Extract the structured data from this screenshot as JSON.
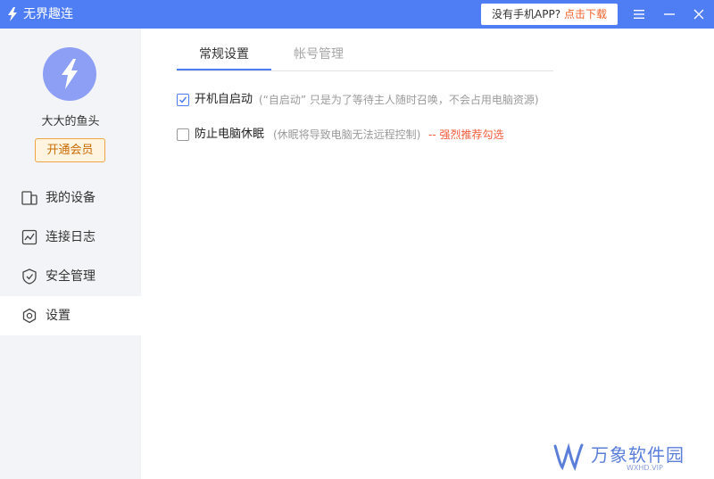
{
  "app": {
    "title": "无界趣连",
    "brand_color": "#4f7df3"
  },
  "titlebar": {
    "download_prompt": "没有手机APP?",
    "download_link": "点击下载",
    "menu_icon": "hamburger-menu-icon",
    "minimize_icon": "minimize-icon",
    "close_icon": "close-icon"
  },
  "sidebar": {
    "username": "大大的鱼头",
    "vip_button": "开通会员",
    "items": [
      {
        "label": "我的设备",
        "icon": "devices-icon",
        "active": false
      },
      {
        "label": "连接日志",
        "icon": "log-chart-icon",
        "active": false
      },
      {
        "label": "安全管理",
        "icon": "shield-icon",
        "active": false
      },
      {
        "label": "设置",
        "icon": "settings-gear-icon",
        "active": true
      }
    ]
  },
  "main": {
    "tabs": [
      {
        "label": "常规设置",
        "active": true
      },
      {
        "label": "帐号管理",
        "active": false
      }
    ],
    "options": [
      {
        "label": "开机自启动",
        "checked": true,
        "hint": "(“自启动” 只是为了等待主人随时召唤，不会占用电脑资源)"
      },
      {
        "label": "防止电脑休眠",
        "checked": false,
        "hint": "(休眠将导致电脑无法远程控制)",
        "recommend": "-- 强烈推荐勾选"
      }
    ]
  },
  "watermark": {
    "text": "万象软件园",
    "sub": "WXHD.VIP"
  }
}
